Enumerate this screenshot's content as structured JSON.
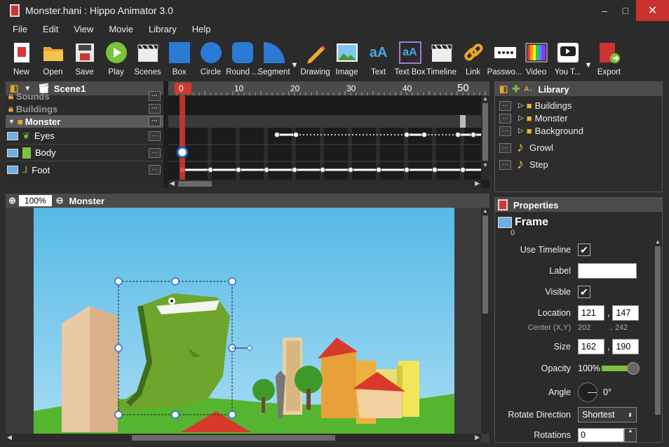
{
  "window": {
    "title": "Monster.hani : Hippo Animator 3.0",
    "minimize": "–",
    "maximize": "□",
    "close": "✕"
  },
  "menu": [
    "File",
    "Edit",
    "View",
    "Movie",
    "Library",
    "Help"
  ],
  "toolbar": [
    {
      "label": "New",
      "icon": "new-icon"
    },
    {
      "label": "Open",
      "icon": "open-folder-icon"
    },
    {
      "label": "Save",
      "icon": "save-disk-icon"
    },
    {
      "label": "Play",
      "icon": "play-icon"
    },
    {
      "label": "Scenes",
      "icon": "clapper-icon"
    },
    {
      "label": "Box",
      "icon": "box-icon"
    },
    {
      "label": "Circle",
      "icon": "circle-icon"
    },
    {
      "label": "Round ...",
      "icon": "round-rect-icon"
    },
    {
      "label": "Segment",
      "icon": "segment-icon"
    },
    {
      "label": "Drawing",
      "icon": "pencil-icon"
    },
    {
      "label": "Image",
      "icon": "image-icon"
    },
    {
      "label": "Text",
      "icon": "text-icon"
    },
    {
      "label": "Text Box",
      "icon": "textbox-icon"
    },
    {
      "label": "Timeline",
      "icon": "timeline-icon"
    },
    {
      "label": "Link",
      "icon": "link-icon"
    },
    {
      "label": "Passwo...",
      "icon": "password-icon"
    },
    {
      "label": "Video",
      "icon": "video-icon"
    },
    {
      "label": "You T...",
      "icon": "youtube-icon"
    },
    {
      "label": "Export",
      "icon": "export-icon"
    }
  ],
  "timeline": {
    "scene": "Scene1",
    "ruler": [
      "0",
      "10",
      "20",
      "30",
      "40",
      "50"
    ],
    "layers": [
      {
        "name": "Sounds",
        "type": "locked"
      },
      {
        "name": "Buildings",
        "type": "locked"
      },
      {
        "name": "Monster",
        "type": "group"
      },
      {
        "name": "Eyes",
        "type": "layer"
      },
      {
        "name": "Body",
        "type": "layer"
      },
      {
        "name": "Foot",
        "type": "layer"
      }
    ],
    "dots_btn": "···"
  },
  "library": {
    "title": "Library",
    "items": [
      {
        "name": "Buildings",
        "kind": "folder"
      },
      {
        "name": "Monster",
        "kind": "folder"
      },
      {
        "name": "Background",
        "kind": "folder"
      },
      {
        "name": "Growl",
        "kind": "sound"
      },
      {
        "name": "Step",
        "kind": "sound"
      }
    ]
  },
  "canvas": {
    "zoom": "100%",
    "name": "Monster"
  },
  "properties": {
    "title": "Properties",
    "object": "Frame",
    "object_index": "0",
    "use_timeline_label": "Use Timeline",
    "label_label": "Label",
    "label_value": "",
    "visible_label": "Visible",
    "location_label": "Location",
    "location_x": "121",
    "location_y": "147",
    "center_label": "Center (X,Y)",
    "center_x": "202",
    "center_y": "242",
    "size_label": "Size",
    "size_w": "162",
    "size_h": "190",
    "opacity_label": "Opacity",
    "opacity_value": "100%",
    "angle_label": "Angle",
    "angle_value": "0°",
    "rotate_label": "Rotate Direction",
    "rotate_value": "Shortest",
    "rotations_label": "Rotations",
    "rotations_value": "0",
    "comma": ","
  },
  "colors": {
    "accent": "#c8332f",
    "panel": "#2b2b2b",
    "sky": "#57b9e3",
    "grass": "#45a72c",
    "monster": "#6ea52c"
  }
}
